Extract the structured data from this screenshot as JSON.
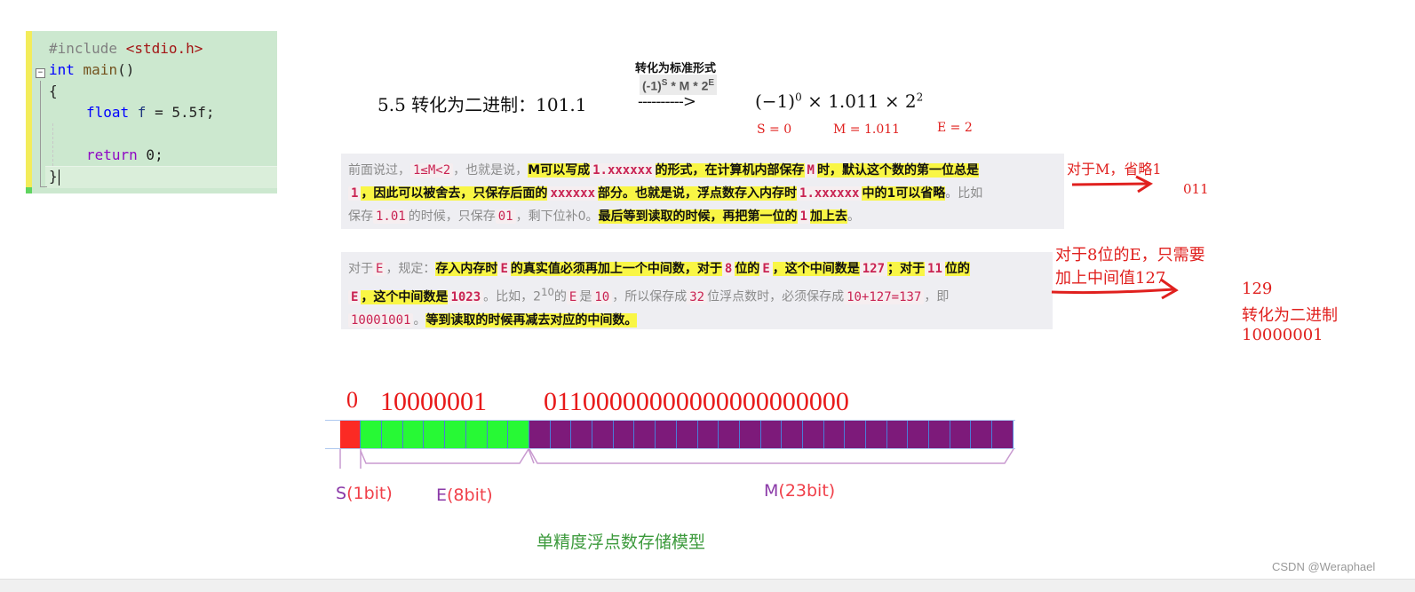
{
  "editor": {
    "lines": {
      "l1_pre": "#include ",
      "l1_inc": "<stdio.h>",
      "l2_kw": "int",
      "l2_fn": " main",
      "l2_rest": "()",
      "l3": "{",
      "l4_kw": "float",
      "l4_var": " f",
      "l4_rest": " = 5.5f;",
      "l6_ctl": "return",
      "l6_rest": " 0;",
      "l7": "}"
    },
    "fold_glyph": "−"
  },
  "header": {
    "caption": "转化为标准形式",
    "formula_base": "(-1)",
    "formula_s": "S",
    "formula_mid": " * M * 2",
    "formula_e": "E",
    "title": "5.5 转化为二进制：101.1",
    "arrow": "---------->",
    "expr_base": "(−1)",
    "expr_exp": "0",
    "expr_mid": " × 1.011 × 2",
    "expr_pow": "2",
    "s_label": "S = 0",
    "m_label": "M = 1.011",
    "e_label": "E = 2"
  },
  "quote_m": {
    "t1": "前面说过，",
    "c1": "1≤M<2",
    "t2": "，也就是说，",
    "h1": "M可以写成",
    "c2": "1.xxxxxx",
    "h2": "的形式，在计算机内部保存",
    "c3": "M",
    "h3": "时，默认这个数的第一位总是",
    "c4": "1",
    "h4": "，因此可以被舍去，只保存后面的",
    "c5": "xxxxxx",
    "h5": "部分。也就是说，浮点数存入内存时",
    "c6": "1.xxxxxx",
    "h6": "中的1可以省略",
    "t3": "。比如",
    "t4": "保存",
    "c7": "1.01",
    "t5": "的时候，只保存",
    "c8": "01",
    "t6": "，剩下位补0。",
    "h7": "最后等到读取的时候，再把第一位的",
    "c9": "1",
    "h8": "加上去",
    "t7": "。"
  },
  "quote_e": {
    "t1": "对于",
    "c1": "E",
    "t2": "，规定：",
    "h1": "存入内存时",
    "c2": "E",
    "h2": "的真实值必须再加上一个中间数，对于",
    "c3": "8",
    "h3": "位的",
    "c4": "E",
    "h4": "，这个中间数是",
    "c5": "127",
    "h5": "；对于",
    "c6": "11",
    "h6": "位的",
    "c7": "E",
    "h7": "，这个中间数是",
    "c8": "1023",
    "t3": "。比如，2",
    "t3sup": "10",
    "t4": "的",
    "c9": "E",
    "t5": "是",
    "c10": "10",
    "t6": "，所以保存成",
    "c11": "32",
    "t7": "位浮点数时，必须保存成",
    "c12": "10+127=137",
    "t8": "，即",
    "c13": "10001001",
    "t9": "。",
    "h8": "等到读取的时候再减去对应的中间数。"
  },
  "annotations": {
    "m_note": "对于M，省略1",
    "m_result": "011",
    "e_note_1": "对于8位的E，只需要",
    "e_note_2": "加上中间值127",
    "e_result_1": "129",
    "e_result_2": "转化为二进制",
    "e_result_3": "10000001"
  },
  "diagram": {
    "sign_bits": "0",
    "exponent_bits": "10000001",
    "mantissa_bits": "01100000000000000000000",
    "segments": [
      {
        "name": "sign",
        "count": 1,
        "color": "#fb2a24"
      },
      {
        "name": "exponent",
        "count": 8,
        "color": "#27f935"
      },
      {
        "name": "mantissa",
        "count": 23,
        "color": "#7d1a7a"
      }
    ],
    "s_letter": "S",
    "s_label": "(1bit)",
    "e_letter": "E",
    "e_label": "(8bit)",
    "m_letter": "M",
    "m_label": "(23bit)",
    "caption": "单精度浮点数存储模型",
    "letter_color": "#8b3aa8",
    "label_color": "#f0404a"
  },
  "watermark": "CSDN @Weraphael"
}
